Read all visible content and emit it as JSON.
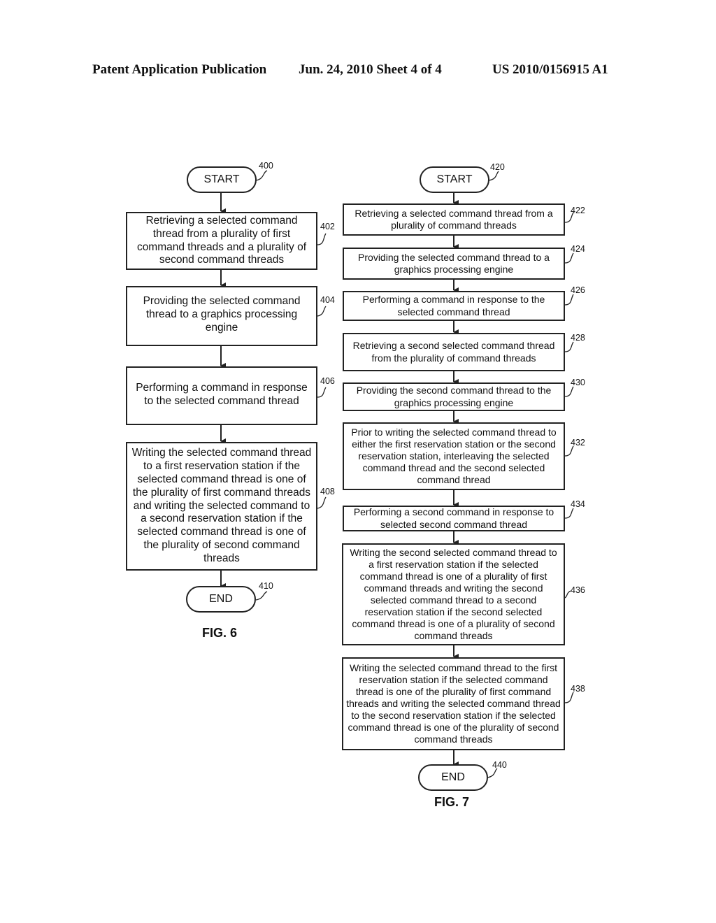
{
  "header": {
    "left": "Patent Application Publication",
    "middle": "Jun. 24, 2010  Sheet 4 of 4",
    "right": "US 2010/0156915 A1"
  },
  "fig6": {
    "caption": "FIG. 6",
    "start": {
      "label": "START",
      "ref": "400"
    },
    "steps": [
      {
        "ref": "402",
        "text": "Retrieving a selected command thread from a plurality of first command threads and a plurality of second command threads"
      },
      {
        "ref": "404",
        "text": "Providing the selected command thread to a graphics processing engine"
      },
      {
        "ref": "406",
        "text": "Performing a command in response to the selected command thread"
      },
      {
        "ref": "408",
        "text": "Writing the selected command thread to a first reservation station if the selected command thread is one of the plurality of first command threads and writing the selected command to a second reservation station if the selected command thread is one of the plurality of second command threads"
      }
    ],
    "end": {
      "label": "END",
      "ref": "410"
    }
  },
  "fig7": {
    "caption": "FIG. 7",
    "start": {
      "label": "START",
      "ref": "420"
    },
    "steps": [
      {
        "ref": "422",
        "text": "Retrieving a selected command thread from a plurality of command threads"
      },
      {
        "ref": "424",
        "text": "Providing the selected command thread to a graphics processing engine"
      },
      {
        "ref": "426",
        "text": "Performing a command in response to the selected command thread"
      },
      {
        "ref": "428",
        "text": "Retrieving a second selected command thread from the plurality of command threads"
      },
      {
        "ref": "430",
        "text": "Providing the second command thread to the graphics processing engine"
      },
      {
        "ref": "432",
        "text": "Prior to writing the selected command thread to either the first reservation station or the second reservation station, interleaving the selected command thread and the second selected command thread"
      },
      {
        "ref": "434",
        "text": "Performing a second command in response to selected second command thread"
      },
      {
        "ref": "436",
        "text": "Writing the second selected command thread to a first reservation station if the selected command thread is one of a plurality of first command threads and writing the second selected command thread to a second reservation station if the second selected command thread is one of a plurality of second command threads"
      },
      {
        "ref": "438",
        "text": "Writing the selected command thread to the first reservation station if the selected command thread is one of the plurality of first command threads and writing the selected command thread to the second reservation station if the selected command thread is one of the plurality of second command threads"
      }
    ],
    "end": {
      "label": "END",
      "ref": "440"
    }
  }
}
